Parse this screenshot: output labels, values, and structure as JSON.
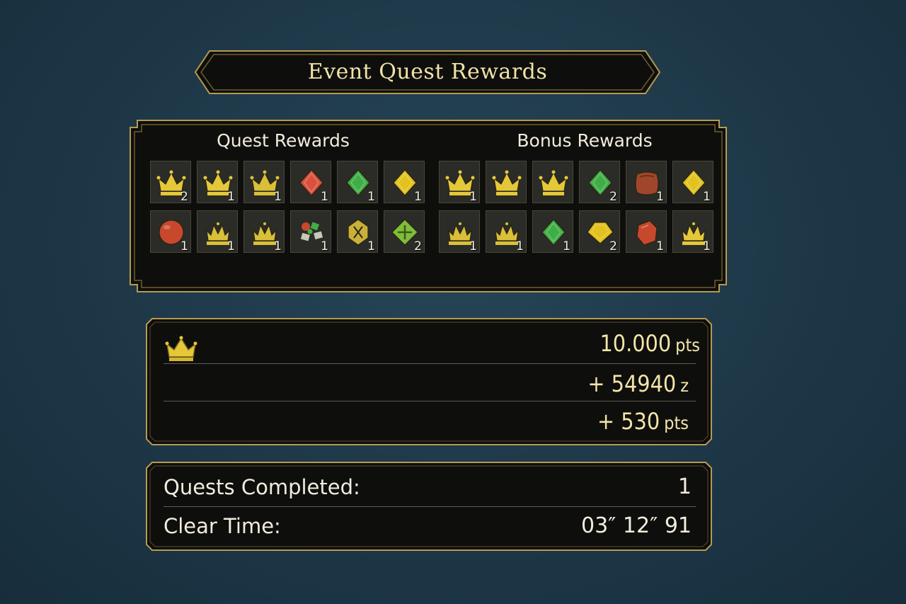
{
  "title": "Event Quest Rewards",
  "sections": {
    "quest": {
      "label": "Quest Rewards",
      "items": [
        {
          "icon": "crown-icon",
          "color": "#e5c83a",
          "qty": "2"
        },
        {
          "icon": "crown-icon",
          "color": "#e5c83a",
          "qty": "1"
        },
        {
          "icon": "crown-icon",
          "color": "#d9bf3a",
          "qty": "1"
        },
        {
          "icon": "gem-diamond-icon",
          "color": "#d9503c",
          "qty": "1"
        },
        {
          "icon": "gem-diamond-icon",
          "color": "#3fae46",
          "qty": "1"
        },
        {
          "icon": "gem-diamond-icon",
          "color": "#e2c21e",
          "qty": "1"
        },
        {
          "icon": "orb-icon",
          "color": "#c8482c",
          "qty": "1"
        },
        {
          "icon": "crown-spiked-icon",
          "color": "#d9bf3a",
          "qty": "1"
        },
        {
          "icon": "crown-spiked-icon",
          "color": "#d9bf3a",
          "qty": "1"
        },
        {
          "icon": "ore-cluster-icon",
          "color": "#3fae46",
          "qty": "1"
        },
        {
          "icon": "shield-cross-icon",
          "color": "#c9b03a",
          "qty": "1"
        },
        {
          "icon": "clover-gem-icon",
          "color": "#7fbd3a",
          "qty": "2"
        }
      ]
    },
    "bonus": {
      "label": "Bonus Rewards",
      "items": [
        {
          "icon": "crown-icon",
          "color": "#e5c83a",
          "qty": "1"
        },
        {
          "icon": "crown-icon",
          "color": "#e5c83a",
          "qty": ""
        },
        {
          "icon": "crown-icon",
          "color": "#e5c83a",
          "qty": ""
        },
        {
          "icon": "gem-diamond-icon",
          "color": "#3fae46",
          "qty": "2"
        },
        {
          "icon": "hide-icon",
          "color": "#a0462c",
          "qty": "1"
        },
        {
          "icon": "gem-diamond-icon",
          "color": "#e2c21e",
          "qty": "1"
        },
        {
          "icon": "crown-spiked-icon",
          "color": "#d9bf3a",
          "qty": "1"
        },
        {
          "icon": "crown-spiked-icon",
          "color": "#d9bf3a",
          "qty": "1"
        },
        {
          "icon": "gem-diamond-icon",
          "color": "#3fae46",
          "qty": "1"
        },
        {
          "icon": "gem-hex-icon",
          "color": "#e2c21e",
          "qty": "2"
        },
        {
          "icon": "ore-icon",
          "color": "#c8482c",
          "qty": "1"
        },
        {
          "icon": "crown-spiked-icon",
          "color": "#e5c83a",
          "qty": "1"
        }
      ]
    }
  },
  "points": {
    "row1": {
      "value": "10.000",
      "unit": "pts"
    },
    "row2": {
      "value": "+ 54940",
      "unit": "z"
    },
    "row3": {
      "value": "+ 530",
      "unit": "pts"
    }
  },
  "stats": {
    "quests_completed_label": "Quests Completed:",
    "quests_completed_value": "1",
    "clear_time_label": "Clear Time:",
    "clear_time_value": "03″ 12″ 91"
  },
  "colors": {
    "accent": "#c9ad5a",
    "background": "#1f3a4a",
    "panel": "#0f0f0d"
  }
}
